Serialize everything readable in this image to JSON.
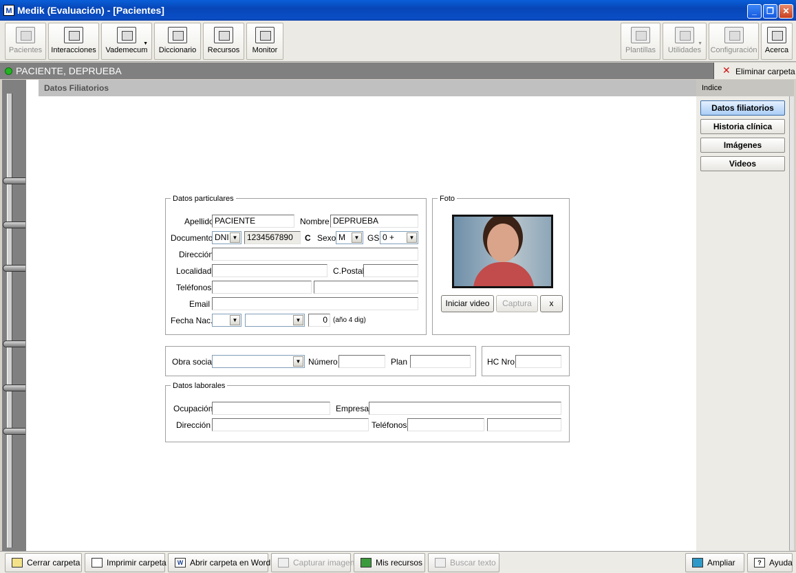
{
  "window": {
    "title": "Medik (Evaluación) - [Pacientes]",
    "app_icon": "M"
  },
  "toolbar": {
    "left": [
      {
        "label": "Pacientes",
        "icon": "binders-icon",
        "enabled": false
      },
      {
        "label": "Interacciones",
        "icon": "interactions-icon",
        "enabled": true
      },
      {
        "label": "Vademecum",
        "icon": "vademecum-icon",
        "enabled": true
      },
      {
        "label": "Diccionario",
        "icon": "dictionary-icon",
        "enabled": true
      },
      {
        "label": "Recursos",
        "icon": "resources-icon",
        "enabled": true
      },
      {
        "label": "Monitor",
        "icon": "monitor-icon",
        "enabled": true
      }
    ],
    "right": [
      {
        "label": "Plantillas",
        "icon": "templates-icon",
        "enabled": false
      },
      {
        "label": "Utilidades",
        "icon": "utilities-icon",
        "enabled": false
      },
      {
        "label": "Configuración",
        "icon": "tools-icon",
        "enabled": false
      },
      {
        "label": "Acerca",
        "icon": "about-icon",
        "enabled": true
      }
    ]
  },
  "patient": {
    "name": "PACIENTE, DEPRUEBA",
    "delete_label": "Eliminar carpeta"
  },
  "section": {
    "title": "Datos Filiatorios"
  },
  "index": {
    "title": "Indice",
    "items": [
      "Datos filiatorios",
      "Historia clínica",
      "Imágenes",
      "Videos"
    ]
  },
  "form": {
    "particulares": {
      "legend": "Datos particulares",
      "apellido_label": "Apellido",
      "apellido": "PACIENTE",
      "nombre_label": "Nombre",
      "nombre": "DEPRUEBA",
      "documento_label": "Documento",
      "doc_tipo": "DNI",
      "doc_numero": "1234567890",
      "doc_c": "C",
      "sexo_label": "Sexo",
      "sexo": "M",
      "gs_label": "GS",
      "gs": "0 +",
      "direccion_label": "Dirección",
      "direccion": "",
      "localidad_label": "Localidad",
      "localidad": "",
      "cpostal_label": "C.Postal",
      "cpostal": "",
      "telefonos_label": "Teléfonos",
      "telefono1": "",
      "telefono2": "",
      "email_label": "Email",
      "email": "",
      "fecha_label": "Fecha Nac.",
      "fecha_dia": "",
      "fecha_mes": "",
      "fecha_anio": "0",
      "fecha_hint": "(año 4 dig)"
    },
    "foto": {
      "legend": "Foto",
      "start_video": "Iniciar video",
      "capture": "Captura",
      "clear": "x"
    },
    "obra": {
      "obra_label": "Obra social",
      "obra": "",
      "numero_label": "Número",
      "numero": "",
      "plan_label": "Plan",
      "plan": ""
    },
    "hc": {
      "label": "HC Nro",
      "value": ""
    },
    "laborales": {
      "legend": "Datos laborales",
      "ocupacion_label": "Ocupación",
      "ocupacion": "",
      "empresa_label": "Empresa",
      "empresa": "",
      "direccion_label": "Dirección",
      "direccion": "",
      "telefonos_label": "Teléfonos",
      "telefono1": "",
      "telefono2": ""
    }
  },
  "statusbar": {
    "left": [
      {
        "label": "Cerrar carpeta",
        "enabled": true
      },
      {
        "label": "Imprimir carpeta",
        "enabled": true
      },
      {
        "label": "Abrir carpeta en Word",
        "enabled": true
      },
      {
        "label": "Capturar imagen",
        "enabled": false
      },
      {
        "label": "Mis recursos",
        "enabled": true
      },
      {
        "label": "Buscar texto",
        "enabled": false
      }
    ],
    "right": [
      {
        "label": "Ampliar",
        "enabled": true
      },
      {
        "label": "Ayuda",
        "enabled": true
      }
    ]
  }
}
